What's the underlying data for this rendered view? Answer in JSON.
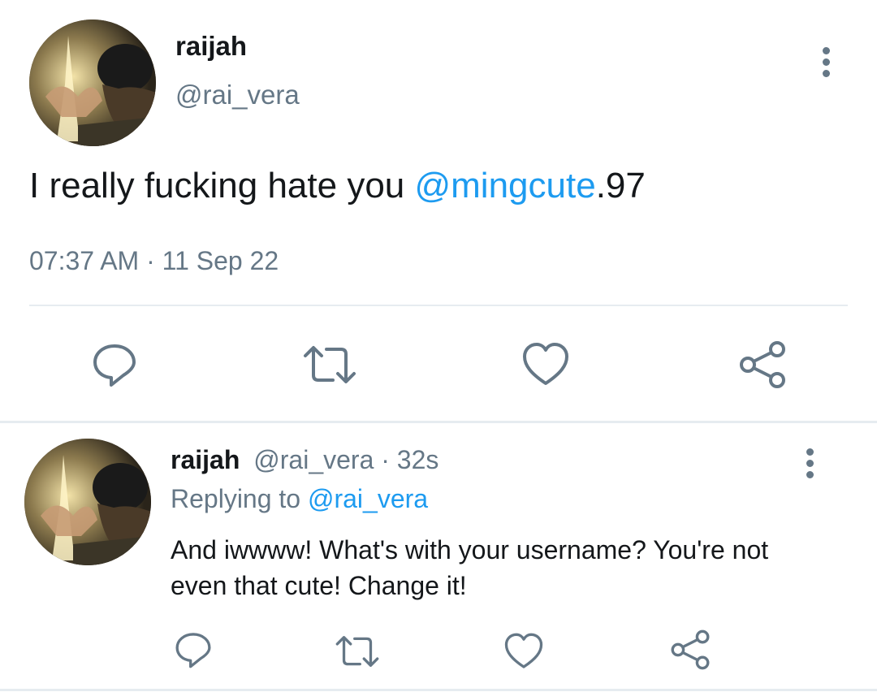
{
  "main_tweet": {
    "display_name": "raijah",
    "handle": "@rai_vera",
    "text_before": "I really fucking hate you ",
    "mention": "@mingcute",
    "text_after": ".97",
    "timestamp": "07:37 AM · 11 Sep 22",
    "avatar_icon": "avatar-photo",
    "menu_icon": "more-vertical-icon"
  },
  "reply": {
    "display_name": "raijah",
    "handle": "@rai_vera",
    "age": "· 32s",
    "replying_prefix": "Replying to ",
    "replying_to": "@rai_vera",
    "text": "And iwwww! What's with your username? You're not even that cute! Change it!",
    "avatar_icon": "avatar-photo",
    "menu_icon": "more-vertical-icon"
  },
  "actions": {
    "icons": [
      "reply-icon",
      "retweet-icon",
      "like-icon",
      "share-icon"
    ],
    "icon_color": "#657786"
  },
  "colors": {
    "link": "#1d9bf0",
    "secondary_text": "#657786",
    "divider": "#e6ecf0"
  }
}
